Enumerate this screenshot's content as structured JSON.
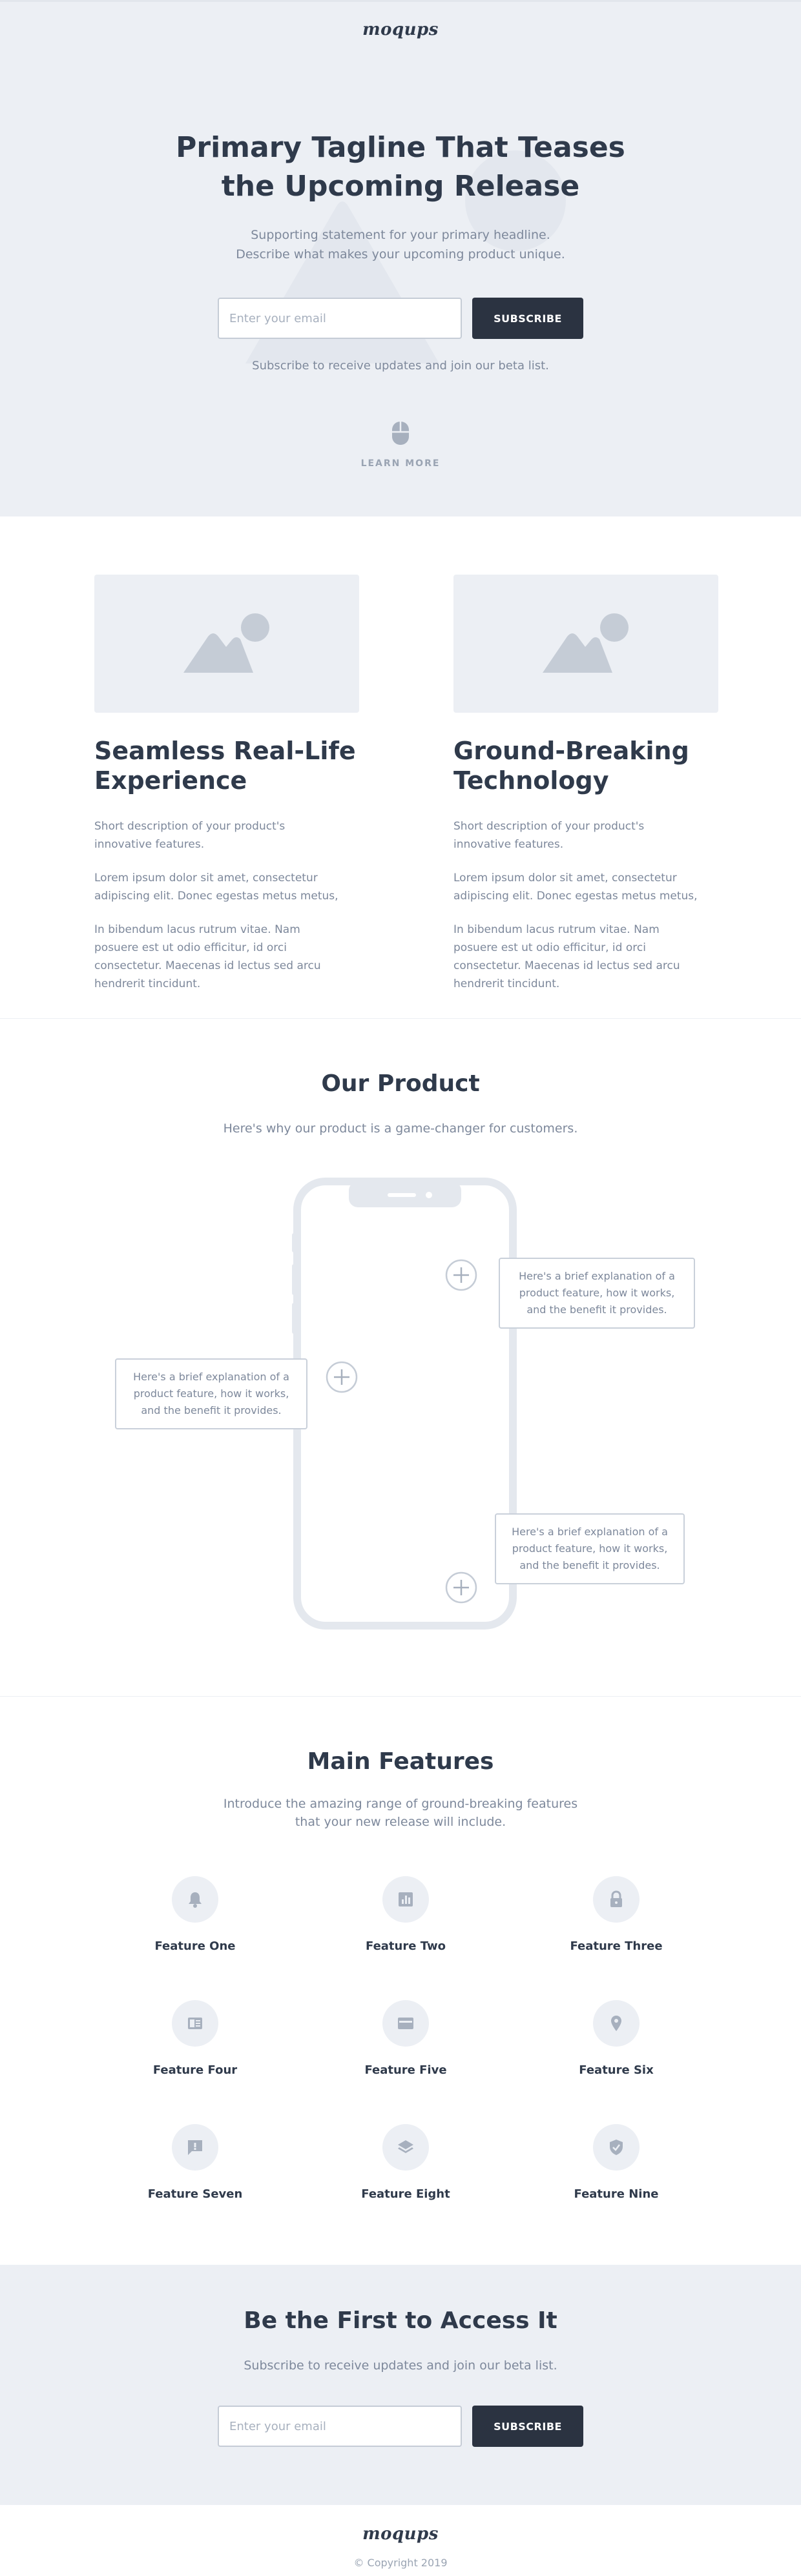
{
  "brand": {
    "logo": "moqups"
  },
  "hero": {
    "title_line1": "Primary Tagline That Teases",
    "title_line2": "the Upcoming Release",
    "subtitle_line1": "Supporting statement for your primary headline.",
    "subtitle_line2": "Describe what makes your upcoming product unique.",
    "email_placeholder": "Enter your email",
    "subscribe_label": "SUBSCRIBE",
    "note": "Subscribe to receive updates and join our beta list.",
    "learn_more": "LEARN MORE"
  },
  "columns": [
    {
      "title_line1": "Seamless Real-Life",
      "title_line2": "Experience",
      "p1": "Short description of your product's innovative features.",
      "p2": "Lorem ipsum dolor sit amet, consectetur adipiscing elit. Donec egestas metus metus,",
      "p3": "In bibendum lacus rutrum vitae. Nam posuere est ut odio efficitur, id orci consectetur. Maecenas id lectus sed arcu hendrerit tincidunt."
    },
    {
      "title_line1": "Ground-Breaking",
      "title_line2": "Technology",
      "p1": "Short description of your product's innovative features.",
      "p2": "Lorem ipsum dolor sit amet, consectetur adipiscing elit. Donec egestas metus metus,",
      "p3": "In bibendum lacus rutrum vitae. Nam posuere est ut odio efficitur, id orci consectetur. Maecenas id lectus sed arcu hendrerit tincidunt."
    }
  ],
  "product": {
    "title": "Our Product",
    "subtitle": "Here's why our product is a game-changer for customers.",
    "callouts": [
      "Here's a brief explanation of a product feature, how it works, and the benefit it provides.",
      "Here's a brief explanation of a product feature, how it works, and the benefit it provides.",
      "Here's a brief explanation of a product feature, how it works, and the benefit it provides."
    ]
  },
  "features": {
    "title": "Main Features",
    "subtitle_line1": "Introduce the amazing range of ground-breaking features",
    "subtitle_line2": "that your new release will include.",
    "items": [
      {
        "label": "Feature One",
        "icon": "bell-icon"
      },
      {
        "label": "Feature Two",
        "icon": "bar-chart-icon"
      },
      {
        "label": "Feature Three",
        "icon": "lock-icon"
      },
      {
        "label": "Feature Four",
        "icon": "newspaper-icon"
      },
      {
        "label": "Feature Five",
        "icon": "credit-card-icon"
      },
      {
        "label": "Feature Six",
        "icon": "map-pin-icon"
      },
      {
        "label": "Feature Seven",
        "icon": "alert-message-icon"
      },
      {
        "label": "Feature Eight",
        "icon": "layers-icon"
      },
      {
        "label": "Feature Nine",
        "icon": "shield-check-icon"
      }
    ]
  },
  "cta": {
    "title": "Be the First to Access It",
    "subtitle": "Subscribe to receive updates and join our beta list.",
    "email_placeholder": "Enter your email",
    "subscribe_label": "SUBSCRIBE"
  },
  "footer": {
    "logo": "moqups",
    "copyright": "© Copyright 2019"
  },
  "colors": {
    "dark": "#2f3a4b",
    "muted": "#7d889b",
    "light_bg": "#eceff4",
    "button": "#2b3341",
    "icon": "#a7b0be"
  }
}
